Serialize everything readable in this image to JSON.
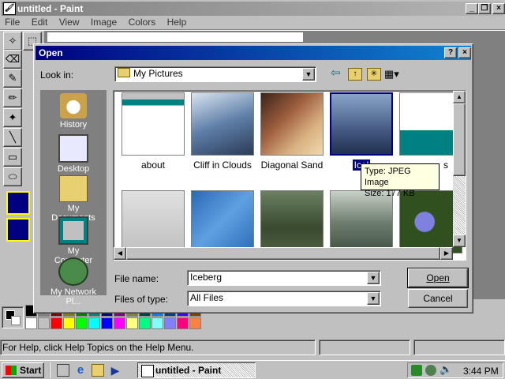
{
  "paint": {
    "title": "untitled - Paint",
    "menu": [
      "File",
      "Edit",
      "View",
      "Image",
      "Colors",
      "Help"
    ],
    "palette": [
      "#000000",
      "#808080",
      "#800000",
      "#808000",
      "#008000",
      "#008080",
      "#000080",
      "#800080",
      "#808040",
      "#004040",
      "#0080ff",
      "#004080",
      "#4000ff",
      "#804000",
      "#ffffff",
      "#c0c0c0",
      "#ff0000",
      "#ffff00",
      "#00ff00",
      "#00ffff",
      "#0000ff",
      "#ff00ff",
      "#ffff80",
      "#00ff80",
      "#80ffff",
      "#8080ff",
      "#ff0080",
      "#ff8040"
    ],
    "status_text": "For Help, click Help Topics on the Help Menu."
  },
  "dialog": {
    "title": "Open",
    "help_btn": "?",
    "close_btn": "×",
    "look_in_label": "Look in:",
    "look_in_value": "My Pictures",
    "places": [
      {
        "label": "History",
        "icon": "history-icon"
      },
      {
        "label": "Desktop",
        "icon": "desktop-icon"
      },
      {
        "label": "My Documents",
        "icon": "my-documents-icon"
      },
      {
        "label": "My Computer",
        "icon": "my-computer-icon"
      },
      {
        "label": "My Network Pl...",
        "icon": "my-network-places-icon"
      }
    ],
    "files_row1": [
      "about",
      "Cliff in Clouds",
      "Diagonal Sand",
      "Iceberg",
      ""
    ],
    "selected_caption": "Icel",
    "partial_caption": "s",
    "tooltip": {
      "type": "Type: JPEG Image",
      "size": "Size: 177 KB"
    },
    "file_name_label": "File name:",
    "file_name_value": "Iceberg",
    "files_of_type_label": "Files of type:",
    "files_of_type_value": "All Files",
    "open_button": "Open",
    "cancel_button": "Cancel"
  },
  "taskbar": {
    "start": "Start",
    "task": "untitled - Paint",
    "clock": "3:44 PM"
  }
}
